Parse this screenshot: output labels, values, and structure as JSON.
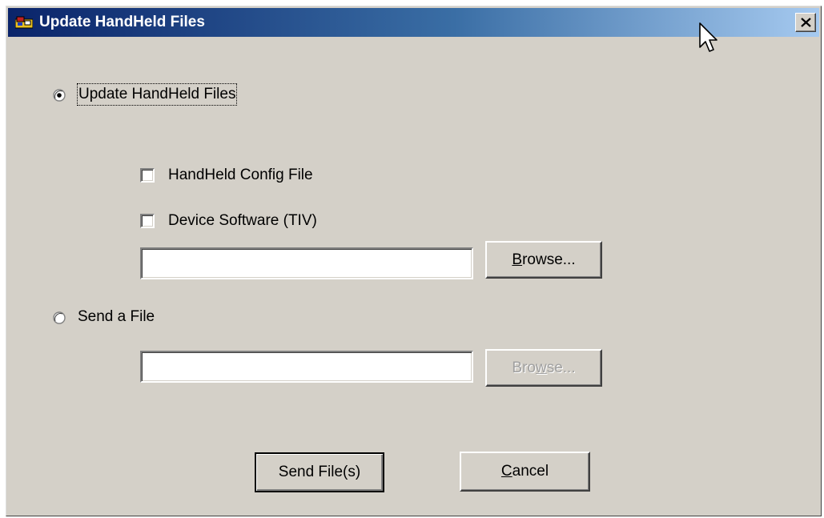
{
  "window": {
    "title": "Update HandHeld Files",
    "close_glyph": "×"
  },
  "options": {
    "update_radio_label": "Update HandHeld Files",
    "update_selected": true,
    "config_checkbox_label": "HandHeld Config File",
    "config_checked": false,
    "device_checkbox_label": "Device Software (TIV)",
    "device_checked": false,
    "update_path_value": "",
    "browse_1": {
      "before": "",
      "underlined": "B",
      "after": "rowse...",
      "enabled": true
    },
    "send_radio_label": "Send a File",
    "send_selected": false,
    "send_path_value": "",
    "browse_2": {
      "before": "Bro",
      "underlined": "w",
      "after": "se...",
      "enabled": false
    }
  },
  "buttons": {
    "send": "Send File(s)",
    "cancel": {
      "underlined": "C",
      "after": "ancel"
    }
  },
  "colors": {
    "dialog_bg": "#d4d0c8",
    "title_start": "#0a246a",
    "title_end": "#a6caf0"
  }
}
